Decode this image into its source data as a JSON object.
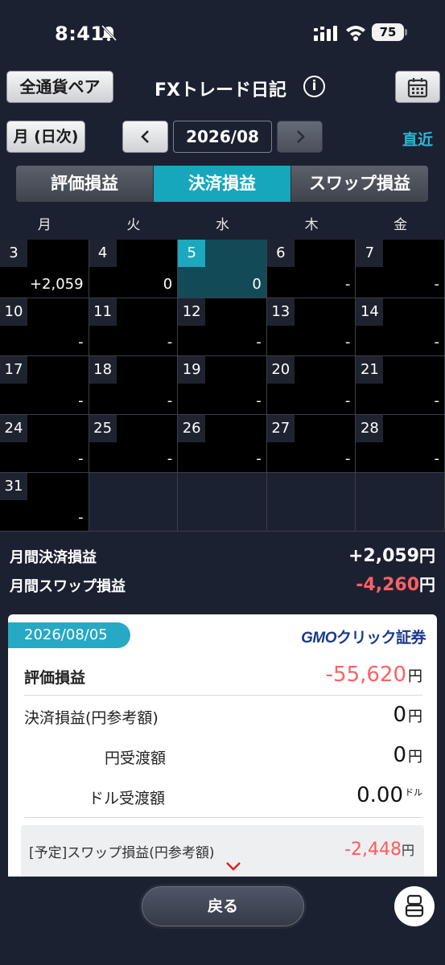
{
  "status_bar": {
    "time": "8:41",
    "battery": "75"
  },
  "header": {
    "pair_button": "全通貨ペア",
    "title": "FXトレード日記",
    "info": "i"
  },
  "nav": {
    "mode_button": "月 (日次)",
    "current_month": "2026/08",
    "recent_link": "直近"
  },
  "tabs": [
    {
      "label": "評価損益"
    },
    {
      "label": "決済損益",
      "active": true
    },
    {
      "label": "スワップ損益"
    }
  ],
  "weekdays": [
    "月",
    "火",
    "水",
    "木",
    "金"
  ],
  "calendar": [
    {
      "day": "3",
      "value": "+2,059"
    },
    {
      "day": "4",
      "value": "0"
    },
    {
      "day": "5",
      "value": "0",
      "selected": true
    },
    {
      "day": "6",
      "value": "-"
    },
    {
      "day": "7",
      "value": "-"
    },
    {
      "day": "10",
      "value": "-"
    },
    {
      "day": "11",
      "value": "-"
    },
    {
      "day": "12",
      "value": "-"
    },
    {
      "day": "13",
      "value": "-"
    },
    {
      "day": "14",
      "value": "-"
    },
    {
      "day": "17",
      "value": "-"
    },
    {
      "day": "18",
      "value": "-"
    },
    {
      "day": "19",
      "value": "-"
    },
    {
      "day": "20",
      "value": "-"
    },
    {
      "day": "21",
      "value": "-"
    },
    {
      "day": "24",
      "value": "-"
    },
    {
      "day": "25",
      "value": "-"
    },
    {
      "day": "26",
      "value": "-"
    },
    {
      "day": "27",
      "value": "-"
    },
    {
      "day": "28",
      "value": "-"
    },
    {
      "day": "31",
      "value": "-"
    }
  ],
  "monthly_summary": {
    "settlement_label": "月間決済損益",
    "settlement_value": "+2,059",
    "swap_label": "月間スワップ損益",
    "swap_value": "-4,260",
    "unit": "円"
  },
  "detail": {
    "date": "2026/08/05",
    "brand_gmo": "GMO",
    "brand_rest": "クリック証券",
    "valuation_label": "評価損益",
    "valuation_value": "-55,620",
    "settlement_label": "決済損益(円参考額)",
    "settlement_value": "0",
    "yen_transfer_label": "円受渡額",
    "yen_transfer_value": "0",
    "dollar_transfer_label": "ドル受渡額",
    "dollar_transfer_value": "0.00",
    "dollar_unit": "ドル",
    "yen_unit": "円",
    "swap_label": "[予定]スワップ損益(円参考額)",
    "swap_value": "-2,448"
  },
  "bottom": {
    "back_button": "戻る"
  },
  "colors": {
    "accent": "#16a7bd",
    "negative": "#ff6064",
    "background": "#1c2131"
  }
}
